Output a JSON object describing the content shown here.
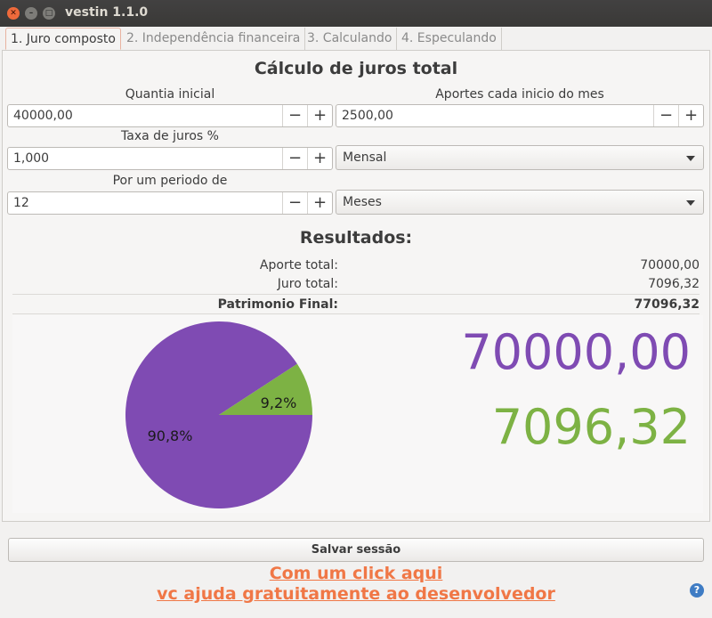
{
  "window": {
    "title": "vestin 1.1.0"
  },
  "tabs": [
    {
      "label": "1. Juro composto"
    },
    {
      "label": "2. Independência financeira"
    },
    {
      "label": "3. Calculando"
    },
    {
      "label": "4. Especulando"
    }
  ],
  "form": {
    "heading": "Cálculo de juros total",
    "initial_amount": {
      "label": "Quantia inicial",
      "value": "40000,00"
    },
    "monthly_contrib": {
      "label": "Aportes cada inicio do mes",
      "value": "2500,00"
    },
    "interest_rate": {
      "label": "Taxa de juros %",
      "value": "1,000"
    },
    "rate_period": {
      "selected": "Mensal"
    },
    "period": {
      "label": "Por um periodo de",
      "value": "12"
    },
    "period_unit": {
      "selected": "Meses"
    },
    "minus": "−",
    "plus": "+"
  },
  "results": {
    "heading": "Resultados:",
    "rows": [
      {
        "label": "Aporte total:",
        "value": "70000,00"
      },
      {
        "label": "Juro total:",
        "value": "7096,32"
      },
      {
        "label": "Patrimonio Final:",
        "value": "77096,32"
      }
    ]
  },
  "chart_data": {
    "type": "pie",
    "slices": [
      {
        "label": "90,8%",
        "value": 90.8,
        "color": "#7f4bb3"
      },
      {
        "label": "9,2%",
        "value": 9.2,
        "color": "#7db244"
      }
    ]
  },
  "big_numbers": {
    "contrib": {
      "text": "70000,00",
      "color": "#7f4bb3"
    },
    "interest": {
      "text": "7096,32",
      "color": "#7db244"
    }
  },
  "footer": {
    "save_label": "Salvar sessão",
    "link_line1": "Com um click aqui",
    "link_line2": "vc ajuda gratuitamente ao desenvolvedor",
    "help_glyph": "?"
  }
}
